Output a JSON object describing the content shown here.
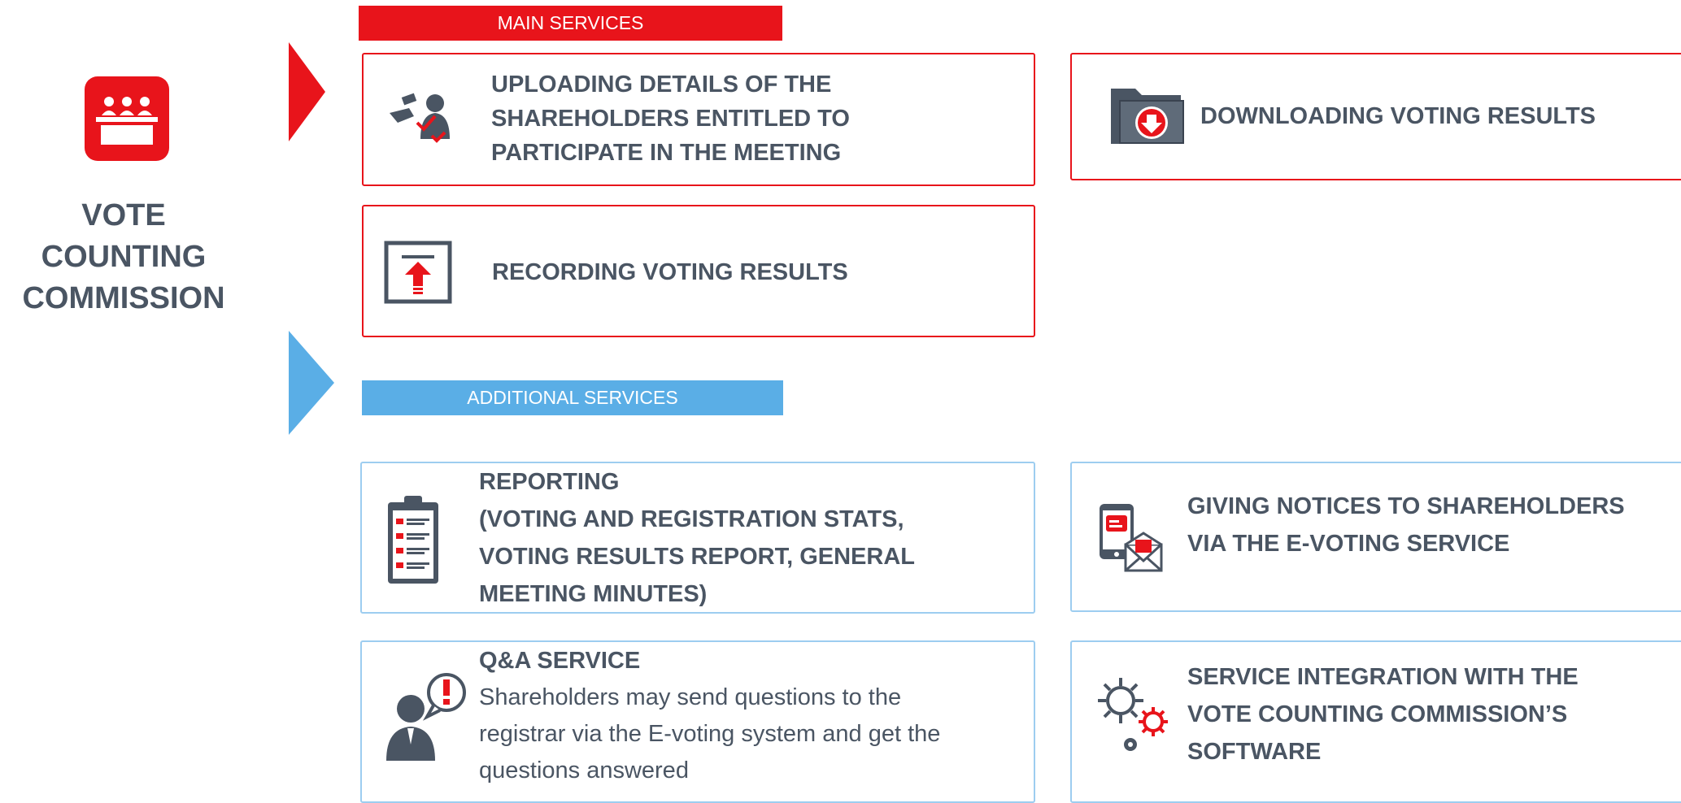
{
  "left": {
    "title_lines": [
      "VOTE",
      "COUNTING",
      "COMMISSION"
    ]
  },
  "main_services": {
    "header": "MAIN SERVICES",
    "cards": [
      {
        "lines": [
          "UPLOADING DETAILS OF THE",
          "SHAREHOLDERS ENTITLED TO",
          "PARTICIPATE IN THE MEETING"
        ],
        "icon": "upload-shareholders-icon"
      },
      {
        "lines": [
          "DOWNLOADING VOTING RESULTS"
        ],
        "icon": "download-folder-icon"
      },
      {
        "lines": [
          "RECORDING VOTING RESULTS"
        ],
        "icon": "upload-box-icon"
      }
    ]
  },
  "additional_services": {
    "header": "ADDITIONAL SERVICES",
    "cards": [
      {
        "title": "REPORTING",
        "lines": [
          "(VOTING AND REGISTRATION STATS,",
          "VOTING RESULTS REPORT, GENERAL",
          "MEETING MINUTES)"
        ],
        "icon": "clipboard-report-icon"
      },
      {
        "lines": [
          "GIVING NOTICES TO SHAREHOLDERS",
          "VIA THE E-VOTING SERVICE"
        ],
        "icon": "phone-envelope-icon"
      },
      {
        "title": "Q&A SERVICE",
        "lines": [
          "Shareholders may send questions to the",
          "registrar via the E-voting system and get the",
          "questions answered"
        ],
        "icon": "person-question-icon"
      },
      {
        "lines": [
          "SERVICE INTEGRATION WITH THE",
          "VOTE COUNTING COMMISSION’S",
          "SOFTWARE"
        ],
        "icon": "gears-icon"
      }
    ]
  },
  "colors": {
    "red": "#e8141b",
    "blue": "#5aaee6",
    "text": "#4a5563"
  }
}
